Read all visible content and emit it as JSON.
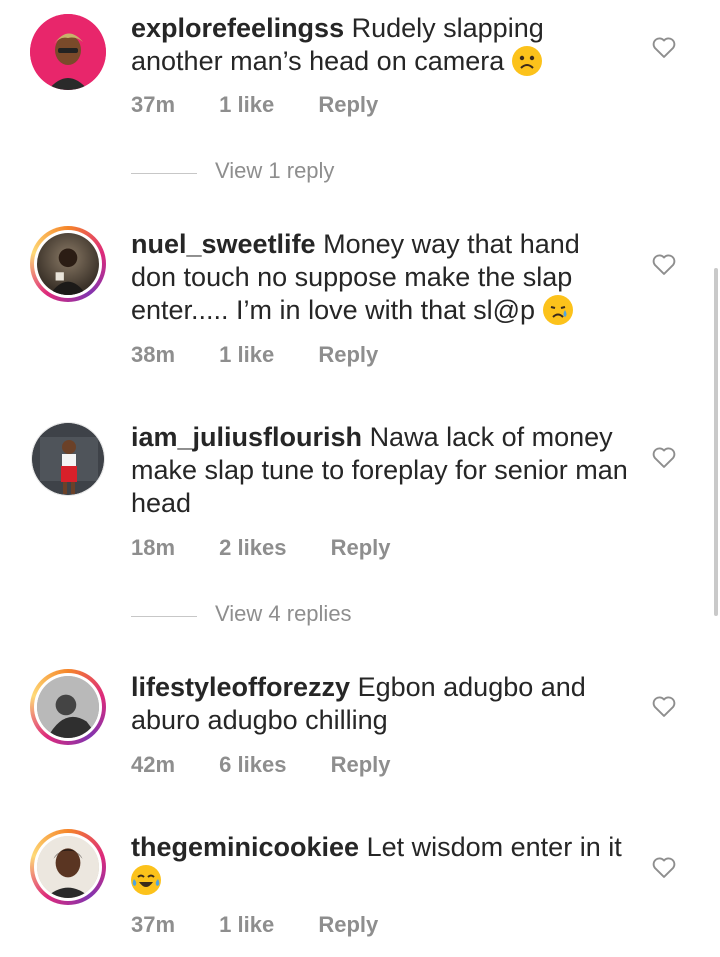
{
  "comments": [
    {
      "username": "explorefeelingss",
      "text": "Rudely slapping another man’s head on camera",
      "emoji": "frowning-face-emoji",
      "time": "37m",
      "likes": "1 like",
      "reply": "Reply",
      "avatar": "bitmoji-avatar"
    },
    {
      "username": "nuel_sweetlife",
      "text": "Money way that hand don touch no suppose make the slap enter..... I’m in love with that sl@p",
      "emoji": "crying-face-emoji",
      "time": "38m",
      "likes": "1 like",
      "reply": "Reply",
      "avatar": "photo-avatar"
    },
    {
      "username": "iam_juliusflourish",
      "text": "Nawa lack of money make slap tune to foreplay for senior man head",
      "emoji": "",
      "time": "18m",
      "likes": "2 likes",
      "reply": "Reply",
      "avatar": "photo-avatar"
    },
    {
      "username": "lifestyleofforezzy",
      "text": "Egbon adugbo and aburo adugbo chilling",
      "emoji": "",
      "time": "42m",
      "likes": "6 likes",
      "reply": "Reply",
      "avatar": "photo-avatar"
    },
    {
      "username": "thegeminicookiee",
      "text": "Let wisdom enter in it",
      "emoji": "tears-of-joy-emoji",
      "time": "37m",
      "likes": "1 like",
      "reply": "Reply",
      "avatar": "photo-avatar"
    }
  ],
  "view_replies": [
    "View 1 reply",
    "View 4 replies"
  ],
  "colors": {
    "text": "#262626",
    "muted": "#8e8e8e",
    "emoji": "#fcc21b"
  }
}
